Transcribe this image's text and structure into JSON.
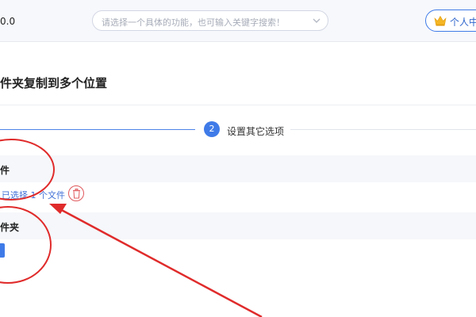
{
  "header": {
    "version_text": "0.0",
    "search": {
      "placeholder": "请选择一个具体的功能，也可输入关键字搜索！"
    },
    "user_button": {
      "label": "个人中"
    }
  },
  "main": {
    "title": "件夹复制到多个位置",
    "steps": [
      {
        "number": "2",
        "label": "设置其它选项"
      }
    ],
    "source_section": {
      "title": "件",
      "selected_text": "已选择 1 个文件"
    },
    "target_section": {
      "title": "件夹"
    }
  },
  "colors": {
    "accent": "#3f7be8",
    "annotation_red": "#e02b2b",
    "delete_red": "#e0595d",
    "section_bg": "#f5f7fa"
  },
  "icons": [
    "chevron-down-icon",
    "crown-icon",
    "trash-icon"
  ]
}
